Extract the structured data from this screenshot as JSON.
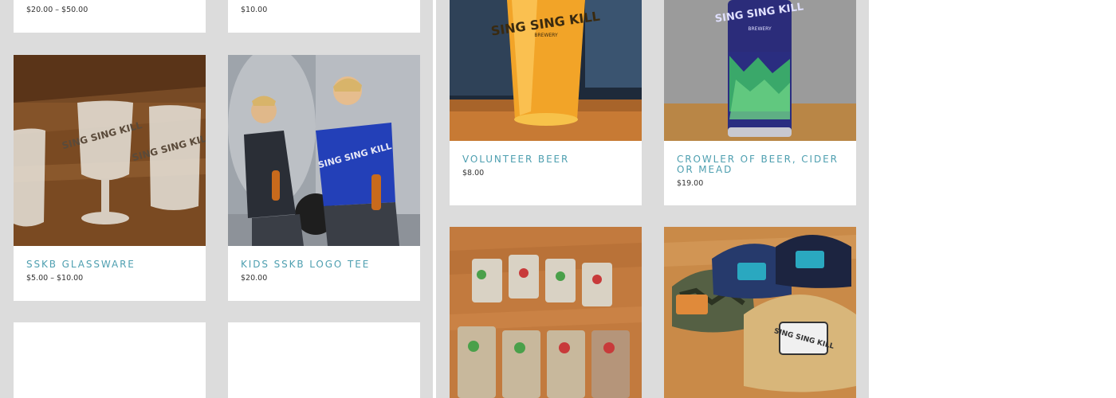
{
  "colors": {
    "panel_background": "#dcdcdc",
    "card_background": "#ffffff",
    "product_title": "#4e9fb0",
    "price_text": "#333333"
  },
  "products": {
    "partial_top_left": {
      "price": "$20.00 – $50.00"
    },
    "partial_top_middle": {
      "price": "$10.00"
    },
    "volunteer_beer": {
      "title": "VOLUNTEER BEER",
      "price": "$8.00",
      "image": "beer-glass-photo"
    },
    "crowler": {
      "title": "CROWLER OF BEER, CIDER OR MEAD",
      "price": "$19.00",
      "image": "crowler-can-photo"
    },
    "sskb_glassware": {
      "title": "SSKB GLASSWARE",
      "price": "$5.00 – $10.00",
      "image": "glassware-photo"
    },
    "kids_tee": {
      "title": "KIDS SSKB LOGO TEE",
      "price": "$20.00",
      "image": "kids-tee-photo"
    },
    "snack_bags": {
      "image": "snack-bags-photo"
    },
    "hats": {
      "image": "hats-photo"
    }
  }
}
